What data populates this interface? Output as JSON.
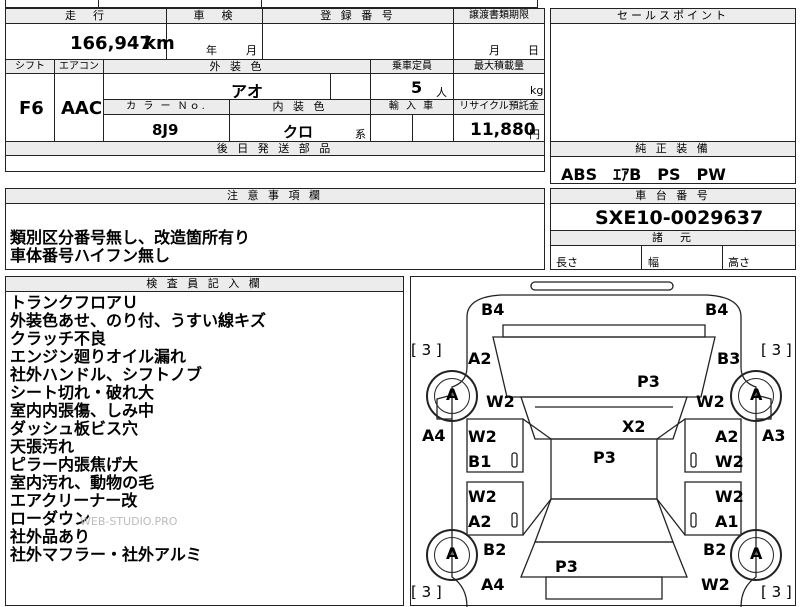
{
  "top": {
    "mileage_header": "走　行",
    "inspection_header": "車　検",
    "registration_header": "登 録 番 号",
    "transfer_header": "譲渡書類期限",
    "sales_point_header": "セールスポイント",
    "mileage_value": "166,947",
    "mileage_unit": "km",
    "inspection_year": "年",
    "inspection_month": "月",
    "transfer_month": "月",
    "transfer_day": "日"
  },
  "row2": {
    "shift_header": "シフト",
    "ac_header": "エアコン",
    "exterior_color_header": "外 装 色",
    "capacity_header": "乗車定員",
    "max_load_header": "最大積載量",
    "exterior_color": "アオ",
    "capacity": "5",
    "capacity_unit": "人",
    "max_load_unit": "kg",
    "shift": "F6",
    "ac": "AAC",
    "color_no_header": "カ ラ ー Ｎｏ.",
    "interior_color_header": "内 装 色",
    "import_header": "輸 入 車",
    "recycle_header": "リサイクル預託金",
    "color_no": "8J9",
    "interior_color": "クロ",
    "interior_suffix": "系",
    "recycle_amount": "11,880",
    "recycle_unit": "円",
    "later_parts_header": "後 日 発 送 部 品"
  },
  "genuine_equipment": {
    "header": "純 正 装 備",
    "value": "ABS　ｴｱB　PS　PW"
  },
  "notes": {
    "header": "注 意 事 項 欄",
    "lines": [
      "類別区分番号無し、改造箇所有り",
      "車体番号ハイフン無し"
    ]
  },
  "chassis": {
    "header": "車 台 番 号",
    "value": "SXE10-0029637",
    "dims_header": "諸　元",
    "length_label": "長さ",
    "width_label": "幅",
    "height_label": "高さ"
  },
  "inspector": {
    "header": "検 査 員 記 入 欄",
    "lines": [
      "トランクフロアＵ",
      "外装色あせ、のり付、うすい線キズ",
      "クラッチ不良",
      "エンジン廻りオイル漏れ",
      "社外ハンドル、シフトノブ",
      "シート切れ・破れ大",
      "室内内張傷、しみ中",
      "ダッシュ板ビス穴",
      "天張汚れ",
      "ピラー内張焦げ大",
      "室内汚れ、動物の毛",
      "エアクリーナー改",
      "ローダウン",
      "社外品あり",
      "社外マフラー・社外アルミ"
    ],
    "watermark": "WEB-STUDIO.PRO"
  },
  "diagram": {
    "tire_marks": [
      "[ 3 ]",
      "[ 3 ]",
      "[ 3 ]",
      "[ 3 ]"
    ],
    "tire_labels": [
      "A",
      "A",
      "A",
      "A"
    ],
    "marks": {
      "b4_left": "B4",
      "b4_right": "B4",
      "a2_left_front": "A2",
      "b3_right_front": "B3",
      "w2_left_front": "W2",
      "w2_right_front": "W2",
      "p3_hood": "P3",
      "x2": "X2",
      "a4_left": "A4",
      "a3_right": "A3",
      "w2_ld1": "W2",
      "b1_ld1": "B1",
      "a2_rd1": "A2",
      "w2_rd1": "W2",
      "p3_roof": "P3",
      "w2_ld2": "W2",
      "a2_ld2": "A2",
      "w2_rd2": "W2",
      "a1_rd2": "A1",
      "b2_left_rear": "B2",
      "b2_right_rear": "B2",
      "p3_trunk": "P3",
      "a4_left_rear": "A4",
      "w2_right_rear": "W2"
    }
  }
}
